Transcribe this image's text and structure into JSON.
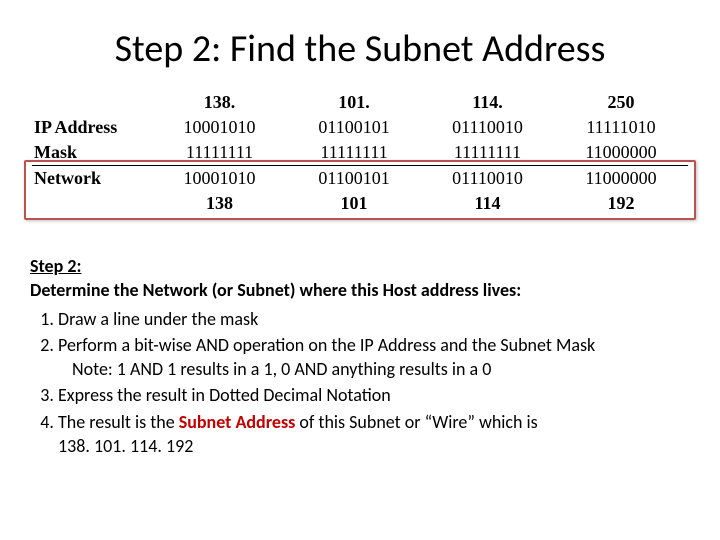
{
  "title": "Step 2: Find the Subnet Address",
  "table": {
    "row_labels": {
      "ip": "IP Address",
      "mask": "Mask",
      "network": "Network"
    },
    "octets": {
      "decimal_top": [
        "138.",
        "101.",
        "114.",
        "250"
      ],
      "ip_bin": [
        "10001010",
        "01100101",
        "01110010",
        "11111010"
      ],
      "mask_bin": [
        "11111111",
        "11111111",
        "11111111",
        "11000000"
      ],
      "net_bin": [
        "10001010",
        "01100101",
        "01110010",
        "11000000"
      ],
      "decimal_bot": [
        "138",
        "101",
        "114",
        "192"
      ]
    }
  },
  "body": {
    "step_label": "Step 2:",
    "subhead": "Determine the Network (or Subnet) where this Host address lives:",
    "items": {
      "i1": "Draw a line under the mask",
      "i2": "Perform a bit-wise AND operation on the IP Address and the Subnet Mask",
      "i2_note": "Note:  1 AND 1 results in a 1, 0 AND anything results in a 0",
      "i3": "Express the result in Dotted Decimal Notation",
      "i4a": "The result is the ",
      "i4_emph": "Subnet Address",
      "i4b": " of this Subnet or “Wire” which is",
      "i4_result": "138. 101. 114. 192"
    }
  }
}
